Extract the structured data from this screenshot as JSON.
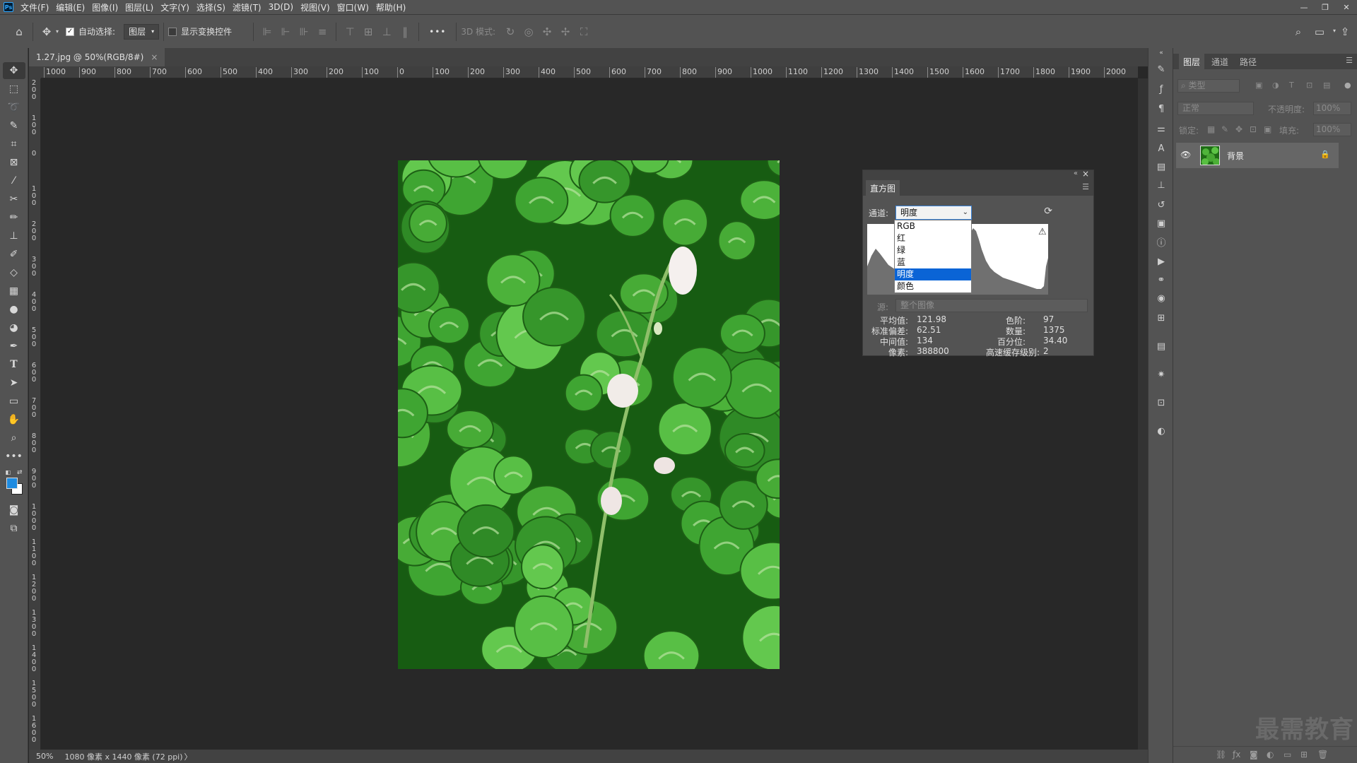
{
  "menubar": {
    "logo": "Ps",
    "items": [
      "文件(F)",
      "编辑(E)",
      "图像(I)",
      "图层(L)",
      "文字(Y)",
      "选择(S)",
      "滤镜(T)",
      "3D(D)",
      "视图(V)",
      "窗口(W)",
      "帮助(H)"
    ],
    "window_buttons": [
      "—",
      "❐",
      "✕"
    ]
  },
  "options": {
    "auto_select_label": "自动选择:",
    "auto_select_value": "图层",
    "show_transform_label": "显示变换控件",
    "more": "•••",
    "mode_3d_label": "3D 模式:"
  },
  "document": {
    "tab_title": "1.27.jpg @ 50%(RGB/8#)",
    "tab_close": "×",
    "zoom": "50%",
    "status_info": "1080 像素 x 1440 像素 (72 ppi)",
    "status_arrow": "〉"
  },
  "rulers": {
    "horizontal": [
      "1000",
      "900",
      "800",
      "700",
      "600",
      "500",
      "400",
      "300",
      "200",
      "100",
      "0",
      "100",
      "200",
      "300",
      "400",
      "500",
      "600",
      "700",
      "800",
      "900",
      "1000",
      "1100",
      "1200",
      "1300",
      "1400",
      "1500",
      "1600",
      "1700",
      "1800",
      "1900",
      "2000"
    ],
    "vertical": [
      "200",
      "100",
      "0",
      "100",
      "200",
      "300",
      "400",
      "500",
      "600",
      "700",
      "800",
      "900",
      "1000",
      "1100",
      "1200",
      "1300",
      "1400",
      "1500",
      "1600"
    ]
  },
  "histogram": {
    "tab": "直方图",
    "channel_label": "通道:",
    "channel_value": "明度",
    "channel_options": [
      "RGB",
      "红",
      "绿",
      "蓝",
      "明度",
      "颜色"
    ],
    "selected_option": "明度",
    "source_label": "源:",
    "source_value": "整个图像",
    "stats": {
      "mean_label": "平均值:",
      "mean": "121.98",
      "std_label": "标准偏差:",
      "std": "62.51",
      "median_label": "中间值:",
      "median": "134",
      "pixels_label": "像素:",
      "pixels": "388800",
      "level_label": "色阶:",
      "level": "97",
      "count_label": "数量:",
      "count": "1375",
      "percentile_label": "百分位:",
      "percentile": "34.40",
      "cache_label": "高速缓存级别:",
      "cache": "2"
    }
  },
  "layers": {
    "tabs": [
      "图层",
      "通道",
      "路径"
    ],
    "filter_placeholder": "类型",
    "blend_mode": "正常",
    "opacity_label": "不透明度:",
    "opacity_value": "100%",
    "lock_label": "锁定:",
    "fill_label": "填充:",
    "fill_value": "100%",
    "layer_name": "背景"
  },
  "watermark": "最需教育",
  "colors": {
    "foreground": "#1e8be0",
    "background": "#ffffff",
    "selection": "#0a64d6"
  }
}
